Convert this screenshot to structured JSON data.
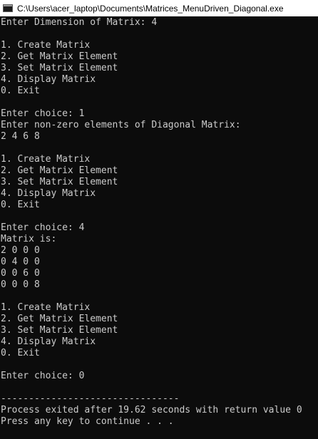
{
  "window": {
    "title": "C:\\Users\\acer_laptop\\Documents\\Matrices_MenuDriven_Diagonal.exe",
    "icon": "console-app-icon"
  },
  "console": {
    "lines": [
      "Enter Dimension of Matrix: 4",
      "",
      "1. Create Matrix",
      "2. Get Matrix Element",
      "3. Set Matrix Element",
      "4. Display Matrix",
      "0. Exit",
      "",
      "Enter choice: 1",
      "Enter non-zero elements of Diagonal Matrix:",
      "2 4 6 8",
      "",
      "1. Create Matrix",
      "2. Get Matrix Element",
      "3. Set Matrix Element",
      "4. Display Matrix",
      "0. Exit",
      "",
      "Enter choice: 4",
      "Matrix is:",
      "2 0 0 0",
      "0 4 0 0",
      "0 0 6 0",
      "0 0 0 8",
      "",
      "1. Create Matrix",
      "2. Get Matrix Element",
      "3. Set Matrix Element",
      "4. Display Matrix",
      "0. Exit",
      "",
      "Enter choice: 0",
      "",
      "--------------------------------",
      "Process exited after 19.62 seconds with return value 0",
      "Press any key to continue . . ."
    ]
  },
  "colors": {
    "background": "#0c0c0c",
    "text": "#cccccc",
    "titlebar": "#ffffff"
  }
}
